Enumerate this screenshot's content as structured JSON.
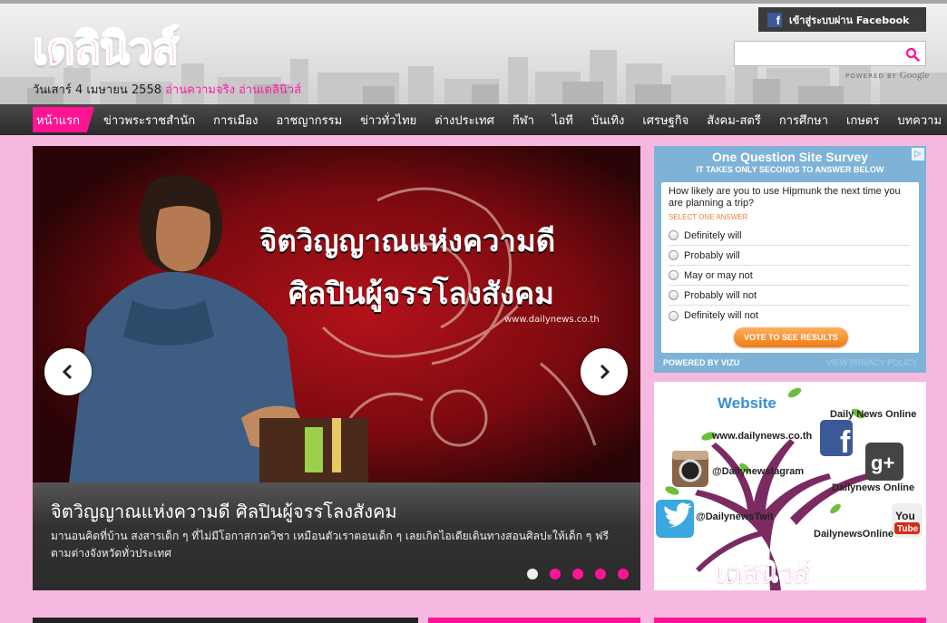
{
  "header": {
    "logo_text": "เดลินิวส์",
    "date": "วันเสาร์ 4 เมษายน 2558",
    "slogan": "อ่านความจริง อ่านเดลินิวส์",
    "facebook_login": "เข้าสู่ระบบผ่าน Facebook",
    "search": {
      "placeholder": "",
      "value": ""
    },
    "powered_by_prefix": "POWERED BY",
    "powered_by_brand": "Google"
  },
  "nav": {
    "items": [
      {
        "label": "หน้าแรก",
        "active": true
      },
      {
        "label": "ข่าวพระราชสำนัก"
      },
      {
        "label": "การเมือง"
      },
      {
        "label": "อาชญากรรม"
      },
      {
        "label": "ข่าวทั่วไทย"
      },
      {
        "label": "ต่างประเทศ"
      },
      {
        "label": "กีฬา"
      },
      {
        "label": "ไอที"
      },
      {
        "label": "บันเทิง"
      },
      {
        "label": "เศรษฐกิจ"
      },
      {
        "label": "สังคม-สตรี"
      },
      {
        "label": "การศึกษา"
      },
      {
        "label": "เกษตร"
      },
      {
        "label": "บทความ"
      }
    ]
  },
  "slider": {
    "image_headline_1": "จิตวิญญาณแห่งความดี",
    "image_headline_2": "ศิลปินผู้จรรโลงสังคม",
    "image_url_text": "www.dailynews.co.th",
    "caption_title": "จิตวิญญาณแห่งความดี ศิลปินผู้จรรโลงสังคม",
    "caption_text": "มานอนคิดที่บ้าน สงสารเด็ก ๆ ที่ไม่มีโอกาสกวดวิชา เหมือนตัวเราตอนเด็ก ๆ เลยเกิดไอเดียเดินทางสอนศิลปะให้เด็ก ๆ ฟรีตามต่างจังหวัดทั่วประเทศ",
    "slide_count": 5,
    "current_slide": 1
  },
  "survey": {
    "title": "One Question Site Survey",
    "subtitle": "IT TAKES ONLY SECONDS TO ANSWER BELOW",
    "question": "How likely are you to use Hipmunk the next time you are planning a trip?",
    "hint": "SELECT ONE ANSWER",
    "options": [
      "Definitely will",
      "Probably will",
      "May or may not",
      "Probably will not",
      "Definitely will not"
    ],
    "vote_button": "VOTE TO SEE RESULTS",
    "powered_by": "POWERED BY VIZU",
    "privacy": "VIEW PRIVACY POLICY",
    "ad_choice": "▷"
  },
  "social": {
    "website_label": "Website",
    "website_url": "www.dailynews.co.th",
    "facebook": "Daily News Online",
    "instagram": "@Dailynewstagram",
    "googleplus": "Dailynews Online",
    "twitter": "@DailynewsTwit",
    "youtube": "DailynewsOnline",
    "logo_text": "เดลินิวส์"
  },
  "colors": {
    "accent": "#ff1493",
    "page_bg": "#f6b8e0",
    "nav_bg": "#333333",
    "facebook": "#3b5998",
    "twitter": "#3aa7e0"
  }
}
